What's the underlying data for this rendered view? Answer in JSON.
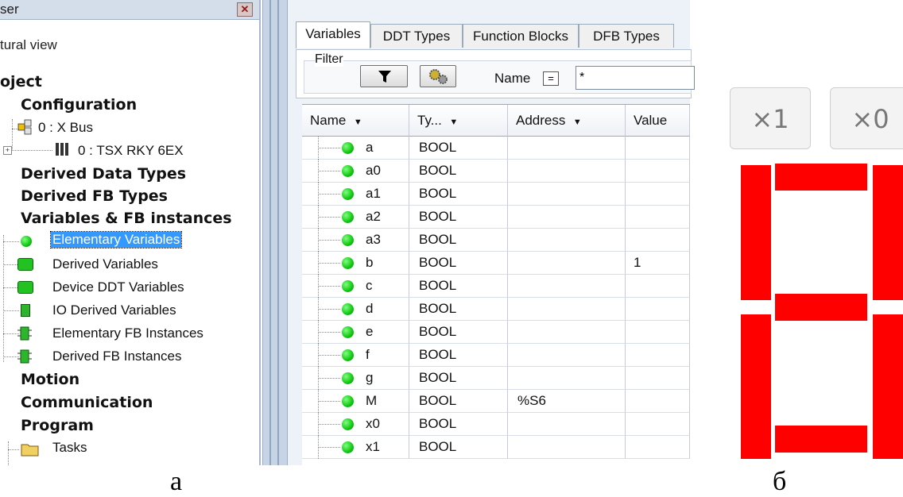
{
  "left_panel": {
    "title": "ser",
    "close_glyph": "✕",
    "view_label": "tural view",
    "root": "oject",
    "configuration": "Configuration",
    "config_items": [
      "0 : X Bus",
      "0 : TSX RKY 6EX"
    ],
    "derived_data_types": "Derived Data Types",
    "derived_fb_types": "Derived FB Types",
    "variables_fb": "Variables & FB instances",
    "var_items": [
      {
        "label": "Elementary Variables",
        "icon": "green-ball-icon",
        "selected": true
      },
      {
        "label": "Derived Variables",
        "icon": "green-cube-icon",
        "selected": false
      },
      {
        "label": "Device DDT Variables",
        "icon": "green-cube-icon",
        "selected": false
      },
      {
        "label": "IO Derived Variables",
        "icon": "green-chip-icon",
        "selected": false
      },
      {
        "label": "Elementary FB Instances",
        "icon": "fb-block-icon",
        "selected": false
      },
      {
        "label": "Derived FB Instances",
        "icon": "fb-block-icon",
        "selected": false
      }
    ],
    "motion": "Motion",
    "communication": "Communication",
    "program": "Program",
    "tasks": "Tasks"
  },
  "editor": {
    "tabs": [
      "Variables",
      "DDT Types",
      "Function Blocks",
      "DFB Types"
    ],
    "active_tab": "Variables",
    "filter_label": "Filter",
    "name_label": "Name",
    "equals_glyph": "=",
    "name_filter_value": "*",
    "columns": [
      "Name",
      "Ty...",
      "Address",
      "Value"
    ],
    "sort_glyph": "▼",
    "rows": [
      {
        "name": "a",
        "type": "BOOL",
        "address": "",
        "value": ""
      },
      {
        "name": "a0",
        "type": "BOOL",
        "address": "",
        "value": ""
      },
      {
        "name": "a1",
        "type": "BOOL",
        "address": "",
        "value": ""
      },
      {
        "name": "a2",
        "type": "BOOL",
        "address": "",
        "value": ""
      },
      {
        "name": "a3",
        "type": "BOOL",
        "address": "",
        "value": ""
      },
      {
        "name": "b",
        "type": "BOOL",
        "address": "",
        "value": "1"
      },
      {
        "name": "c",
        "type": "BOOL",
        "address": "",
        "value": ""
      },
      {
        "name": "d",
        "type": "BOOL",
        "address": "",
        "value": ""
      },
      {
        "name": "e",
        "type": "BOOL",
        "address": "",
        "value": ""
      },
      {
        "name": "f",
        "type": "BOOL",
        "address": "",
        "value": ""
      },
      {
        "name": "g",
        "type": "BOOL",
        "address": "",
        "value": ""
      },
      {
        "name": "M",
        "type": "BOOL",
        "address": "%S6",
        "value": ""
      },
      {
        "name": "x0",
        "type": "BOOL",
        "address": "",
        "value": ""
      },
      {
        "name": "x1",
        "type": "BOOL",
        "address": "",
        "value": ""
      }
    ]
  },
  "simulator": {
    "buttons": [
      "×1",
      "×0"
    ],
    "segment_color": "#ff0000",
    "segments_on": [
      "a",
      "b",
      "c",
      "d",
      "e",
      "f",
      "g"
    ]
  },
  "captions": {
    "left": "а",
    "right": "б"
  }
}
